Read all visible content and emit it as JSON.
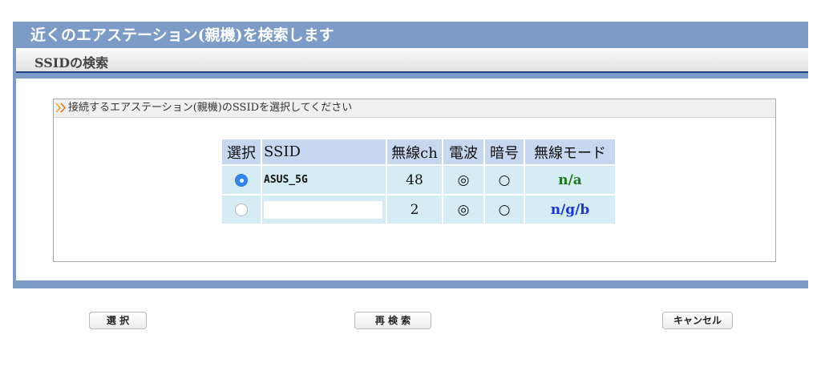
{
  "header": {
    "title": "近くのエアステーション(親機)を検索します",
    "subtitle": "SSIDの検索"
  },
  "section": {
    "title": "接続するエアステーション(親機)のSSIDを選択してください",
    "icon": "double-chevron-icon"
  },
  "table": {
    "headers": {
      "select": "選択",
      "ssid": "SSID",
      "channel": "無線ch",
      "signal": "電波",
      "encryption": "暗号",
      "mode": "無線モード"
    },
    "rows": [
      {
        "selected": true,
        "ssid": "ASUS_5G",
        "channel": "48",
        "signal": "◎",
        "encryption": "○",
        "mode": "n/a",
        "mode_color": "#1f7a1f"
      },
      {
        "selected": false,
        "ssid": "",
        "channel": "2",
        "signal": "◎",
        "encryption": "○",
        "mode": "n/g/b",
        "mode_color": "#1c36d4"
      }
    ]
  },
  "buttons": {
    "select": "選 択",
    "rescan": "再 検 索",
    "cancel": "キャンセル"
  },
  "colors": {
    "panel": "#7c9bc7",
    "header_cell": "#c7d7ef",
    "row_cell": "#d5ecf5",
    "radio_selected": "#2f86f0"
  }
}
